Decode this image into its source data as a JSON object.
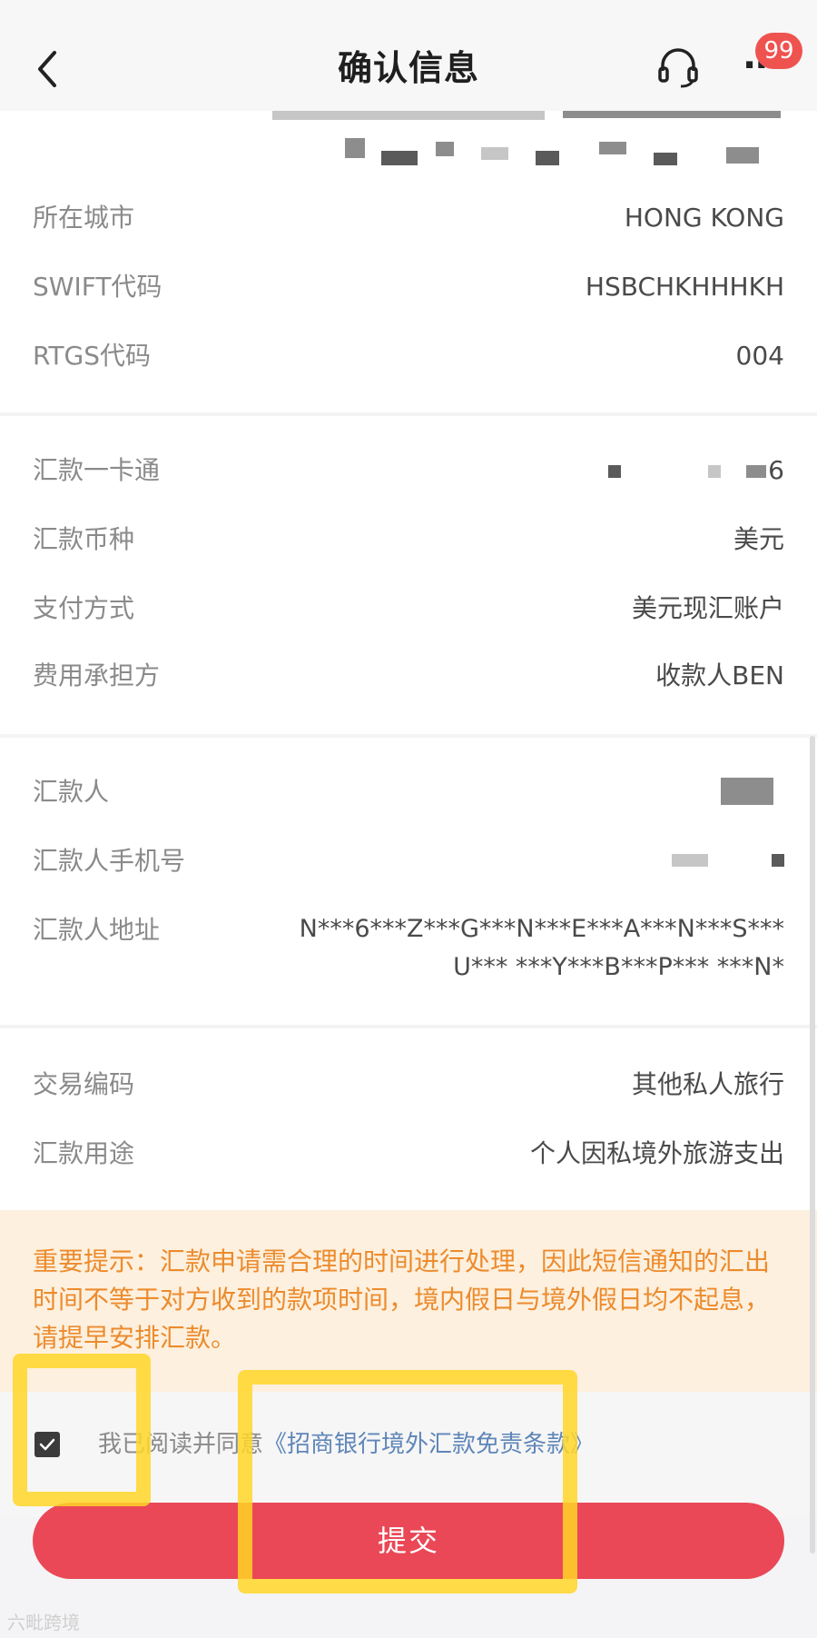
{
  "header": {
    "title": "确认信息",
    "badge": "99",
    "icons": {
      "back": "chevron-left-icon",
      "service": "headset-icon",
      "more": "more-icon"
    }
  },
  "section_bank": {
    "rows": [
      {
        "label": "所在城市",
        "value": "HONG KONG"
      },
      {
        "label": "SWIFT代码",
        "value": "HSBCHKHHHKH"
      },
      {
        "label": "RTGS代码",
        "value": "004"
      }
    ]
  },
  "section_payment": {
    "rows": [
      {
        "label": "汇款一卡通",
        "value": "6"
      },
      {
        "label": "汇款币种",
        "value": "美元"
      },
      {
        "label": "支付方式",
        "value": "美元现汇账户"
      },
      {
        "label": "费用承担方",
        "value": "收款人BEN"
      }
    ]
  },
  "section_remitter": {
    "rows": [
      {
        "label": "汇款人",
        "value": ""
      },
      {
        "label": "汇款人手机号",
        "value": ""
      },
      {
        "label": "汇款人地址",
        "value_line1": "N***6***Z***G***N***E***A***N***S***",
        "value_line2": "U*** ***Y***B***P*** ***N*"
      }
    ]
  },
  "section_purpose": {
    "rows": [
      {
        "label": "交易编码",
        "value": "其他私人旅行"
      },
      {
        "label": "汇款用途",
        "value": "个人因私境外旅游支出"
      }
    ]
  },
  "notice": "重要提示：汇款申请需合理的时间进行处理，因此短信通知的汇出时间不等于对方收到的款项时间，境内假日与境外假日均不起息，请提早安排汇款。",
  "agree": {
    "text": "我已阅读并同意",
    "link": "《招商银行境外汇款免责条款》",
    "checked": true
  },
  "submit_label": "提交",
  "watermark": "六毗跨境",
  "colors": {
    "accent": "#ea4856",
    "notice_bg": "#fdf0de",
    "notice_text": "#ec8b2d",
    "link": "#5f86b8",
    "badge": "#ef5350"
  }
}
